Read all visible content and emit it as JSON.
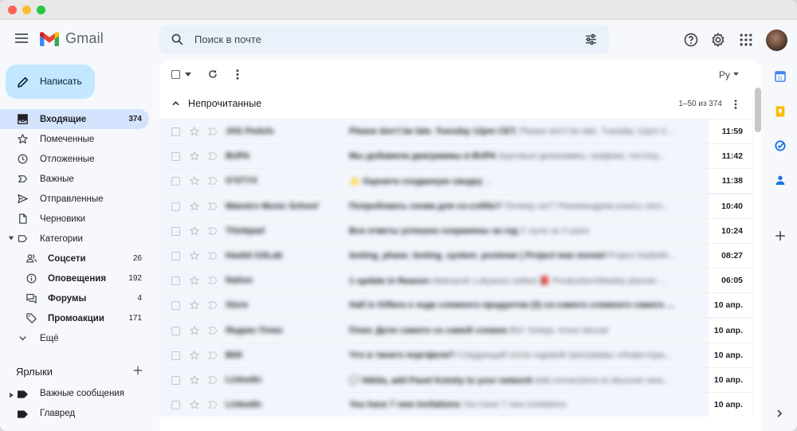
{
  "app": {
    "name": "Gmail"
  },
  "search": {
    "placeholder": "Поиск в почте"
  },
  "compose": {
    "label": "Написать"
  },
  "nav": [
    {
      "name": "inbox",
      "label": "Входящие",
      "count": "374",
      "icon": "inbox-icon",
      "active": true
    },
    {
      "name": "starred",
      "label": "Помеченные",
      "count": "",
      "icon": "star-icon"
    },
    {
      "name": "snoozed",
      "label": "Отложенные",
      "count": "",
      "icon": "clock-icon"
    },
    {
      "name": "important",
      "label": "Важные",
      "count": "",
      "icon": "important-icon"
    },
    {
      "name": "sent",
      "label": "Отправленные",
      "count": "",
      "icon": "send-icon"
    },
    {
      "name": "drafts",
      "label": "Черновики",
      "count": "",
      "icon": "draft-icon"
    },
    {
      "name": "categories",
      "label": "Категории",
      "count": "",
      "icon": "label-icon"
    },
    {
      "name": "social",
      "label": "Соцсети",
      "count": "26",
      "icon": "people-icon"
    },
    {
      "name": "updates",
      "label": "Оповещения",
      "count": "192",
      "icon": "info-icon"
    },
    {
      "name": "forums",
      "label": "Форумы",
      "count": "4",
      "icon": "forum-icon"
    },
    {
      "name": "promotions",
      "label": "Промоакции",
      "count": "171",
      "icon": "tag-icon"
    },
    {
      "name": "more",
      "label": "Ещё",
      "count": "",
      "icon": "chevron-down-icon"
    }
  ],
  "labels": {
    "title": "Ярлыки",
    "items": [
      {
        "label": "Важные сообщения"
      },
      {
        "label": "Главред"
      }
    ]
  },
  "toolbar": {
    "language": "Ру"
  },
  "section": {
    "title": "Непрочитанные",
    "range": "1–50 из 374"
  },
  "emails": [
    {
      "sender": "JHS Pedols",
      "subject": "Please don't be late. Tuesday 12pm CET.",
      "snippet": "Please don't be late. Tuesday 12pm C...",
      "date": "11:59"
    },
    {
      "sender": "BUPA",
      "subject": "Мы добавили диаграммы в BUPA",
      "snippet": "Круговые диаграммы, графики, гистогр...",
      "date": "11:42"
    },
    {
      "sender": "O'STYX",
      "subject": "⭐ Оцените созданную сводку",
      "snippet": "...",
      "date": "11:38"
    },
    {
      "sender": "Maestro Music School",
      "subject": "Попробовать снова для со-соббо?",
      "snippet": "Почему нет? Рекомендуем узнать сего...",
      "date": "10:40"
    },
    {
      "sender": "Thinkpad",
      "subject": "Все ответы успешно сохранены за год",
      "snippet": "С нуля за 3 шага",
      "date": "10:24"
    },
    {
      "sender": "Hasbit GitLab",
      "subject": "testing_phase_testing_system_postman | Project was moved",
      "snippet": "Project hasbeth...",
      "date": "08:27"
    },
    {
      "sender": "Nation",
      "subject": "1 update in Reason",
      "snippet": "Aleksandr Lukyanov edited 📕 Production/Weekly planner ...",
      "date": "06:05"
    },
    {
      "sender": "Store",
      "subject": "Hall is Giftera о ходе сложного продуктов (3) со-самого сложного самого ...",
      "snippet": "",
      "date": "10 апр."
    },
    {
      "sender": "Яндекс Плюс",
      "subject": "Плюс Дело самого со самой сложно",
      "snippet": "Вот теперь точно весна!",
      "date": "10 апр."
    },
    {
      "sender": "ВКК",
      "subject": "Что в твоего портфеля?",
      "snippet": "Следующий поток годовой программы «Инвестора...",
      "date": "10 апр."
    },
    {
      "sender": "LinkedIn",
      "subject": "💬 Nikita, add Pavel Kolotiy to your network",
      "snippet": "Add connections to discover new...",
      "date": "10 апр."
    },
    {
      "sender": "LinkedIn",
      "subject": "You have 7 new invitations",
      "snippet": "You have 7 new invitations",
      "date": "10 апр."
    }
  ],
  "colors": {
    "accent": "#d3e3fd",
    "compose": "#c2e7ff",
    "search": "#eaf1fb",
    "background": "#f6f8fc"
  }
}
